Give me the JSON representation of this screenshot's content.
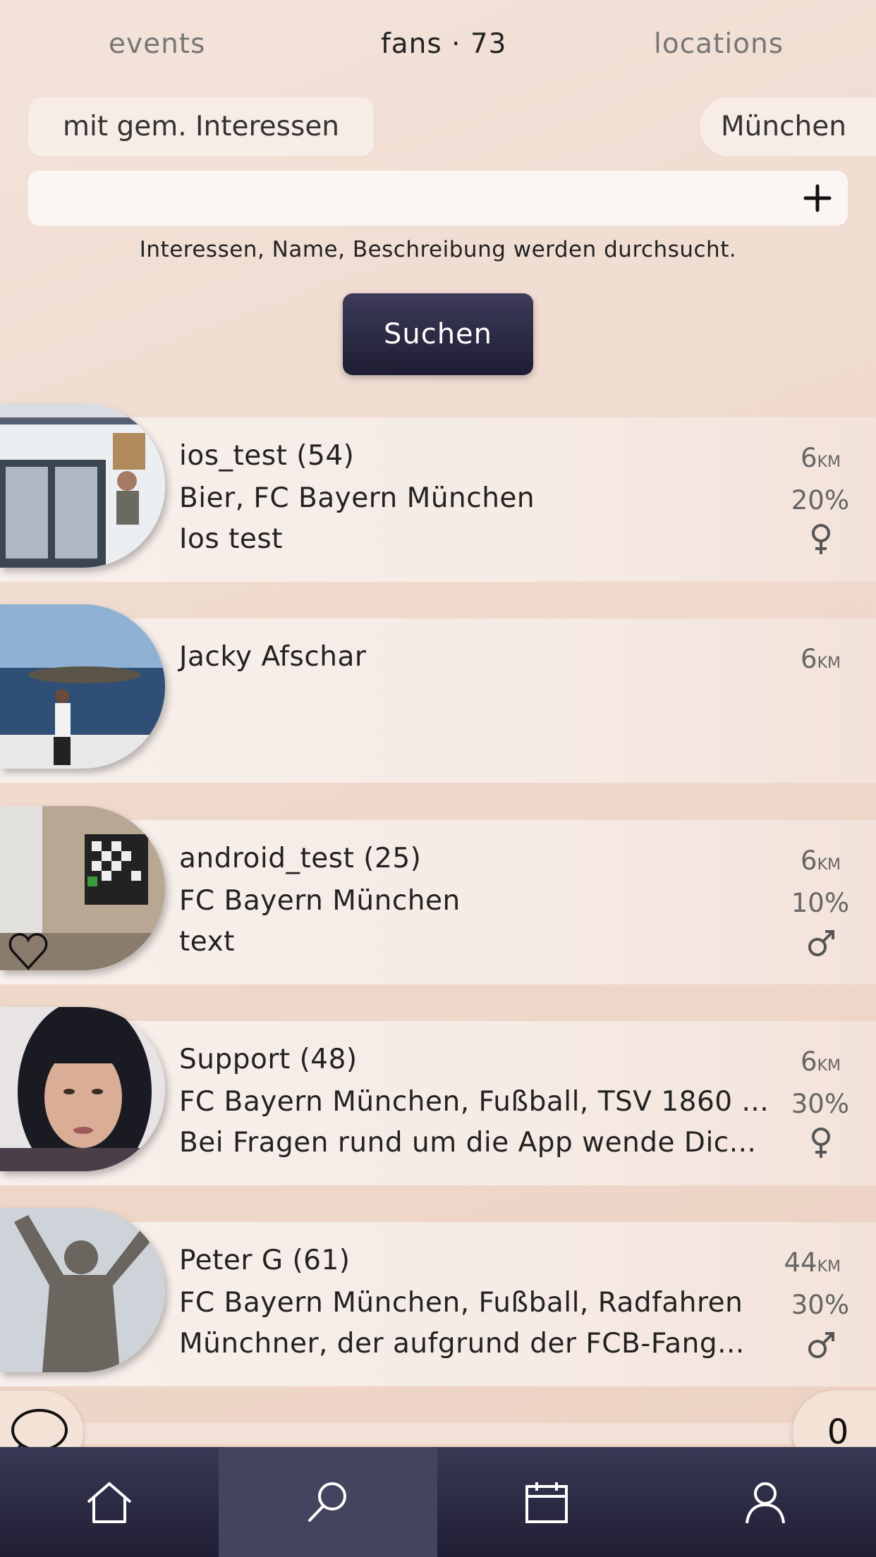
{
  "tabs": [
    {
      "label": "events"
    },
    {
      "label": "fans · 73"
    },
    {
      "label": "locations"
    }
  ],
  "filters": {
    "interests": "mit gem. Interessen",
    "city": "München"
  },
  "search": {
    "value": "",
    "hint": "Interessen, Name, Beschreibung werden durchsucht.",
    "button_label": "Suchen"
  },
  "fans": [
    {
      "name": "ios_test (54)",
      "interests": "Bier, FC Bayern München",
      "description": "Ios test",
      "distance": "6",
      "unit": "KM",
      "match": "20%",
      "gender": "female",
      "favorite": false
    },
    {
      "name": "Jacky Afschar",
      "interests": "",
      "description": "",
      "distance": "6",
      "unit": "KM",
      "match": "",
      "gender": "",
      "favorite": false
    },
    {
      "name": "android_test (25)",
      "interests": "FC Bayern München",
      "description": "text",
      "distance": "6",
      "unit": "KM",
      "match": "10%",
      "gender": "male",
      "favorite": true
    },
    {
      "name": "Support (48)",
      "interests": "FC Bayern München, Fußball, TSV 1860 ...",
      "description": "Bei Fragen rund um die App wende Dic...",
      "distance": "6",
      "unit": "KM",
      "match": "30%",
      "gender": "female",
      "favorite": false
    },
    {
      "name": "Peter G (61)",
      "interests": "FC Bayern München, Fußball, Radfahren",
      "description": "Münchner, der aufgrund der FCB-Fang...",
      "distance": "44",
      "unit": "KM",
      "match": "30%",
      "gender": "male",
      "favorite": false
    }
  ],
  "floating": {
    "count": "0"
  },
  "nav": [
    {
      "icon": "home-icon"
    },
    {
      "icon": "search-icon",
      "active": true
    },
    {
      "icon": "calendar-icon"
    },
    {
      "icon": "profile-icon"
    }
  ]
}
